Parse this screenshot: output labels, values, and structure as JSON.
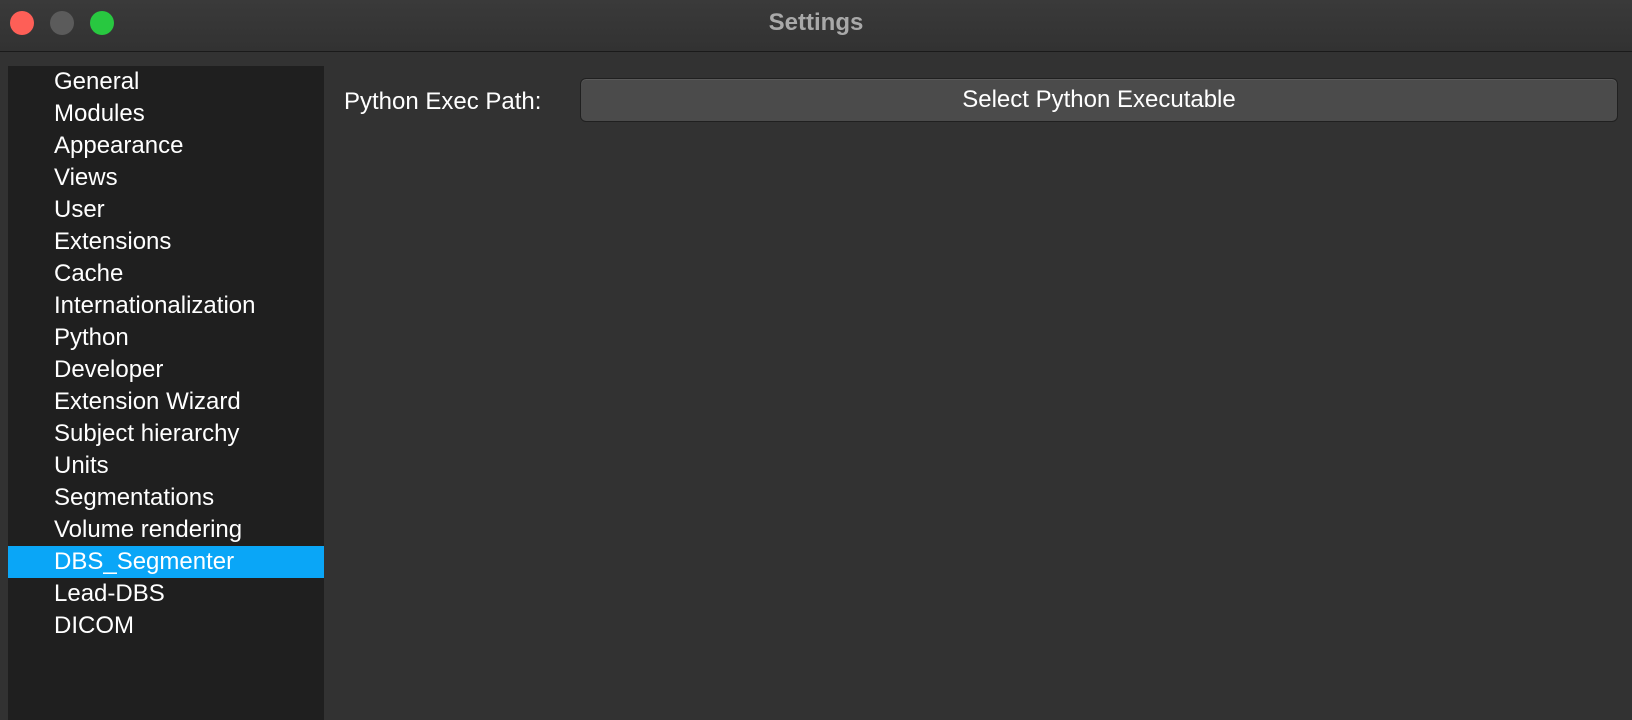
{
  "window": {
    "title": "Settings"
  },
  "sidebar": {
    "items": [
      {
        "label": "General"
      },
      {
        "label": "Modules"
      },
      {
        "label": "Appearance"
      },
      {
        "label": "Views"
      },
      {
        "label": "User"
      },
      {
        "label": "Extensions"
      },
      {
        "label": "Cache"
      },
      {
        "label": "Internationalization"
      },
      {
        "label": "Python"
      },
      {
        "label": "Developer"
      },
      {
        "label": "Extension Wizard"
      },
      {
        "label": "Subject hierarchy"
      },
      {
        "label": "Units"
      },
      {
        "label": "Segmentations"
      },
      {
        "label": "Volume rendering"
      },
      {
        "label": "DBS_Segmenter",
        "selected": true
      },
      {
        "label": "Lead-DBS"
      },
      {
        "label": "DICOM"
      }
    ],
    "selected_color": "#0aa6f7"
  },
  "main": {
    "python_exec_label": "Python Exec Path:",
    "select_button_label": "Select Python Executable"
  }
}
